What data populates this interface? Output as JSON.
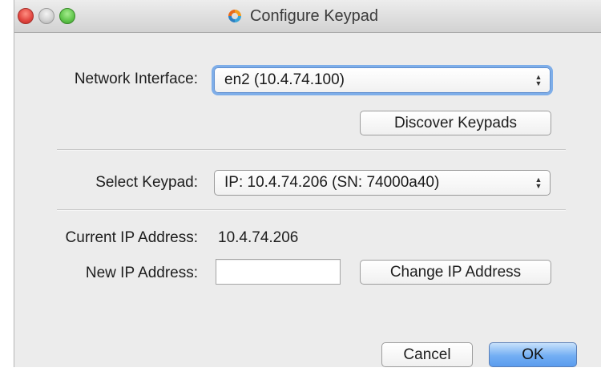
{
  "window": {
    "title": "Configure Keypad",
    "traffic_lights": [
      "close",
      "minimize",
      "zoom"
    ]
  },
  "network_interface": {
    "label": "Network Interface:",
    "selected": "en2 (10.4.74.100)"
  },
  "discover_button": {
    "label": "Discover Keypads"
  },
  "keypad": {
    "label": "Select Keypad:",
    "selected": "IP: 10.4.74.206 (SN: 74000a40)"
  },
  "current_ip": {
    "label": "Current IP Address:",
    "value": "10.4.74.206"
  },
  "new_ip": {
    "label": "New IP Address:",
    "value": ""
  },
  "change_ip_button": {
    "label": "Change IP Address"
  },
  "footer": {
    "cancel_label": "Cancel",
    "ok_label": "OK"
  },
  "colors": {
    "window_bg": "#ececec",
    "focus_ring": "#7eaee9",
    "primary_button": "#73aef3"
  },
  "icons": [
    "close-traffic-light",
    "minimize-traffic-light",
    "zoom-traffic-light",
    "app-icon",
    "popup-arrows-icon"
  ]
}
